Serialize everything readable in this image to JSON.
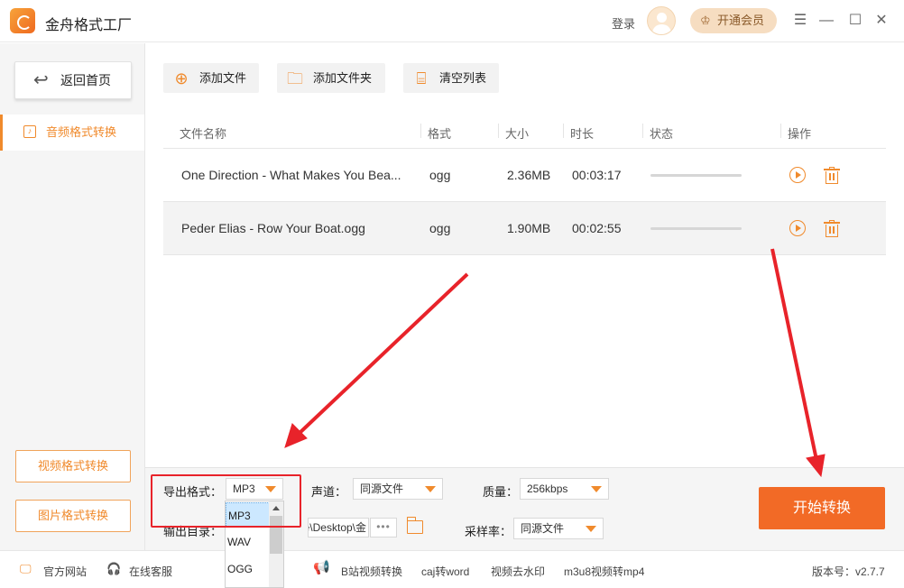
{
  "app": {
    "title": "金舟格式工厂",
    "login": "登录",
    "vip_label": "开通会员",
    "window_controls": [
      "menu-icon",
      "minimize-icon",
      "maximize-icon",
      "close-icon"
    ]
  },
  "sidebar": {
    "back_home": "返回首页",
    "nav_active": "音频格式转换",
    "video_convert": "视频格式转换",
    "image_convert": "图片格式转换"
  },
  "toolbar": {
    "add_file": "添加文件",
    "add_folder": "添加文件夹",
    "clear_list": "清空列表"
  },
  "table": {
    "headers": [
      "文件名称",
      "格式",
      "大小",
      "时长",
      "状态",
      "操作"
    ],
    "rows": [
      {
        "name": "One Direction - What Makes You Bea...",
        "format": "ogg",
        "size": "2.36MB",
        "duration": "00:03:17"
      },
      {
        "name": "Peder Elias - Row Your Boat.ogg",
        "format": "ogg",
        "size": "1.90MB",
        "duration": "00:02:55"
      }
    ]
  },
  "settings": {
    "format_label": "导出格式：",
    "format_value": "MP3",
    "channel_label": "声道：",
    "channel_value": "同源文件",
    "quality_label": "质量：",
    "quality_value": "256kbps",
    "output_label": "输出目录：",
    "output_path": "kate\\Desktop\\金",
    "more": "•••",
    "samplerate_label": "采样率：",
    "samplerate_value": "同源文件",
    "dropdown_options": [
      "MP3",
      "WAV",
      "OGG"
    ],
    "start_button": "开始转换"
  },
  "footer": {
    "website": "官方网站",
    "service": "在线客服",
    "links": [
      "B站视频转换",
      "caj转word",
      "视频去水印",
      "m3u8视频转mp4"
    ],
    "version": "版本号：v2.7.7"
  },
  "colors": {
    "accent": "#f08a2c",
    "start_button": "#f26a26",
    "annotation": "#e8232a"
  }
}
